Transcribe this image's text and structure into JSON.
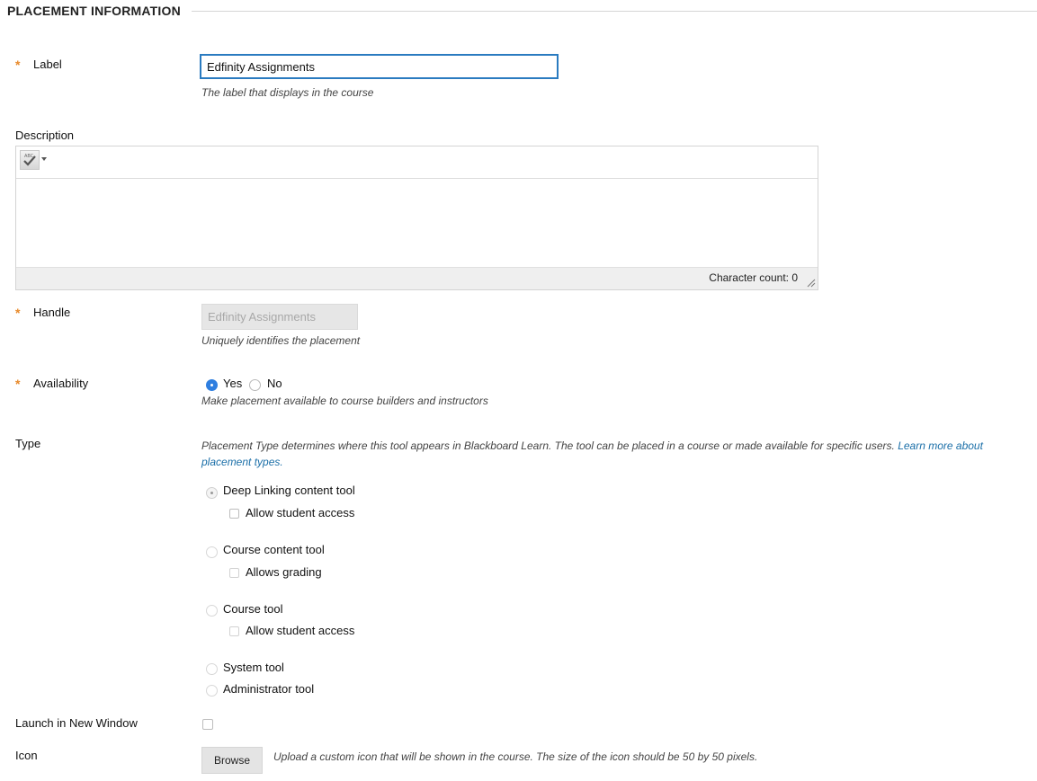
{
  "section": {
    "title": "PLACEMENT INFORMATION"
  },
  "label_field": {
    "label": "Label",
    "value": "Edfinity Assignments",
    "hint": "The label that displays in the course"
  },
  "description": {
    "label": "Description",
    "char_count": "Character count: 0",
    "spellcheck_icon_text": "ABC"
  },
  "handle": {
    "label": "Handle",
    "value": "Edfinity Assignments",
    "hint": "Uniquely identifies the placement"
  },
  "availability": {
    "label": "Availability",
    "yes": "Yes",
    "no": "No",
    "selected": "Yes",
    "hint": "Make placement available to course builders and instructors"
  },
  "type": {
    "label": "Type",
    "description": "Placement Type determines where this tool appears in Blackboard Learn. The tool can be placed in a course or made available for specific users.",
    "link_text": "Learn more about placement types.",
    "options": [
      {
        "label": "Deep Linking content tool",
        "sub": "Allow student access"
      },
      {
        "label": "Course content tool",
        "sub": "Allows grading"
      },
      {
        "label": "Course tool",
        "sub": "Allow student access"
      },
      {
        "label": "System tool"
      },
      {
        "label": "Administrator tool"
      }
    ],
    "selected": "Deep Linking content tool"
  },
  "launch_new_window": {
    "label": "Launch in New Window"
  },
  "icon": {
    "label": "Icon",
    "browse": "Browse",
    "hint": "Upload a custom icon that will be shown in the course. The size of the icon should be 50 by 50 pixels."
  },
  "colors": {
    "required_star": "#e88a2a",
    "focus_border": "#2a7bc0",
    "link": "#1b6fa8",
    "radio_selected": "#2f7fe0"
  }
}
